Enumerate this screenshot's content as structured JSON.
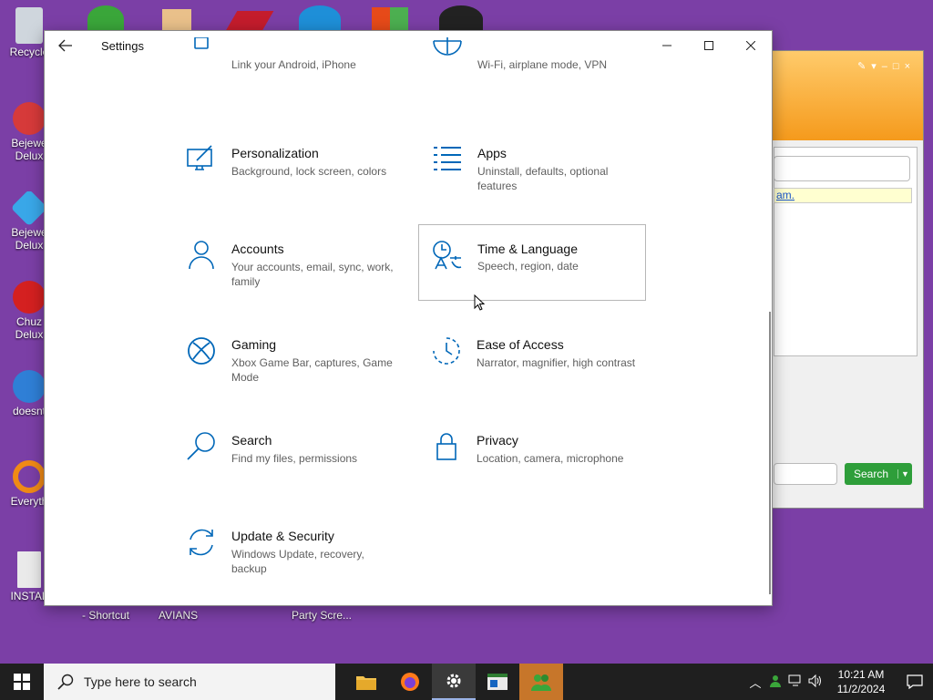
{
  "desktop": {
    "icons": [
      {
        "label": "Recycle",
        "color": "#d0d8e0"
      },
      {
        "label": "Bejewe Delux",
        "color": "#d63a3a"
      },
      {
        "label": "Bejewe Delux",
        "color": "#39a7e8"
      },
      {
        "label": "Chuz Delux",
        "color": "#d42020"
      },
      {
        "label": "doesnt",
        "color": "#2f7fd6"
      },
      {
        "label": "Everyth",
        "color": "#f08a16"
      },
      {
        "label": "INSTAL",
        "color": "#e8e8e8"
      }
    ],
    "bottom_labels": [
      "- Shortcut",
      "AVIANS",
      "Party Scre..."
    ]
  },
  "bg_window": {
    "link_text": "am.",
    "search_label": "Search"
  },
  "settings": {
    "title": "Settings",
    "accent": "#0067b8",
    "tiles": [
      {
        "name": "",
        "desc": "Link your Android, iPhone",
        "icon": "phone-icon"
      },
      {
        "name": "",
        "desc": "Wi-Fi, airplane mode, VPN",
        "icon": "globe-icon"
      },
      {
        "name": "Personalization",
        "desc": "Background, lock screen, colors",
        "icon": "personalization-icon"
      },
      {
        "name": "Apps",
        "desc": "Uninstall, defaults, optional features",
        "icon": "apps-icon"
      },
      {
        "name": "Accounts",
        "desc": "Your accounts, email, sync, work, family",
        "icon": "person-icon"
      },
      {
        "name": "Time & Language",
        "desc": "Speech, region, date",
        "icon": "time-language-icon"
      },
      {
        "name": "Gaming",
        "desc": "Xbox Game Bar, captures, Game Mode",
        "icon": "xbox-icon"
      },
      {
        "name": "Ease of Access",
        "desc": "Narrator, magnifier, high contrast",
        "icon": "ease-of-access-icon"
      },
      {
        "name": "Search",
        "desc": "Find my files, permissions",
        "icon": "search-icon"
      },
      {
        "name": "Privacy",
        "desc": "Location, camera, microphone",
        "icon": "lock-icon"
      },
      {
        "name": "Update & Security",
        "desc": "Windows Update, recovery, backup",
        "icon": "refresh-icon"
      }
    ]
  },
  "taskbar": {
    "search_placeholder": "Type here to search",
    "time": "10:21 AM",
    "date": "11/2/2024"
  }
}
